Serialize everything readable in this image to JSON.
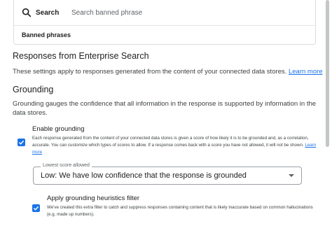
{
  "search": {
    "label": "Search",
    "placeholder": "Search banned phrase"
  },
  "banned_table": {
    "header": "Banned phrases"
  },
  "responses_section": {
    "title": "Responses from Enterprise Search",
    "description": "These settings apply to responses generated from the content of your connected data stores.",
    "learn_more": "Learn more"
  },
  "grounding_section": {
    "title": "Grounding",
    "description": "Grounding gauges the confidence that all information in the response is supported by information in the data stores."
  },
  "enable_grounding": {
    "checked": true,
    "title": "Enable grounding",
    "description": "Each response generated from the content of your connected data stores is given a score of how likely it is to be grounded and, as a correlation, accurate. You can customize which types of scores to allow. If a response comes back with a score you have not allowed, it will not be shown.",
    "learn_more": "Learn more"
  },
  "lowest_score": {
    "label": "Lowest score allowed",
    "value": "Low: We have low confidence that the response is grounded"
  },
  "heuristics_filter": {
    "checked": true,
    "title": "Apply grounding heuristics filter",
    "description": "We've created this extra filter to catch and suppress responses containing content that is likely inaccurate based on common hallucinations (e.g. made up numbers)."
  },
  "colors": {
    "accent": "#1a73e8",
    "text": "#202124",
    "muted": "#5f6368"
  }
}
